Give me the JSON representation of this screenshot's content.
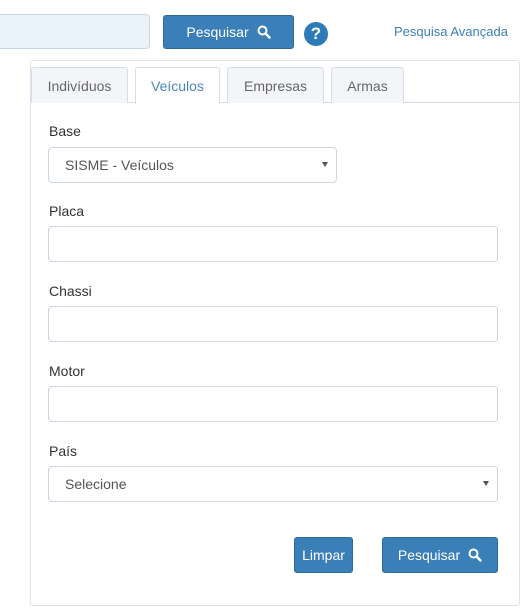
{
  "header": {
    "search_button_label": "Pesquisar",
    "help_icon_glyph": "?",
    "advanced_search_link": "Pesquisa Avançada"
  },
  "tabs": [
    {
      "label": "Indivíduos",
      "active": false
    },
    {
      "label": "Veículos",
      "active": true
    },
    {
      "label": "Empresas",
      "active": false
    },
    {
      "label": "Armas",
      "active": false
    }
  ],
  "form": {
    "base_label": "Base",
    "base_selected": "SISME - Veículos",
    "placa_label": "Placa",
    "placa_value": "",
    "chassi_label": "Chassi",
    "chassi_value": "",
    "motor_label": "Motor",
    "motor_value": "",
    "pais_label": "País",
    "pais_selected": "Selecione"
  },
  "actions": {
    "clear_label": "Limpar",
    "search_label": "Pesquisar"
  },
  "colors": {
    "primary": "#3a7fb8",
    "active_tab_text": "#4a86c0"
  },
  "icons": {
    "search": "search-icon",
    "help": "help-icon",
    "caret": "chevron-down-icon"
  }
}
